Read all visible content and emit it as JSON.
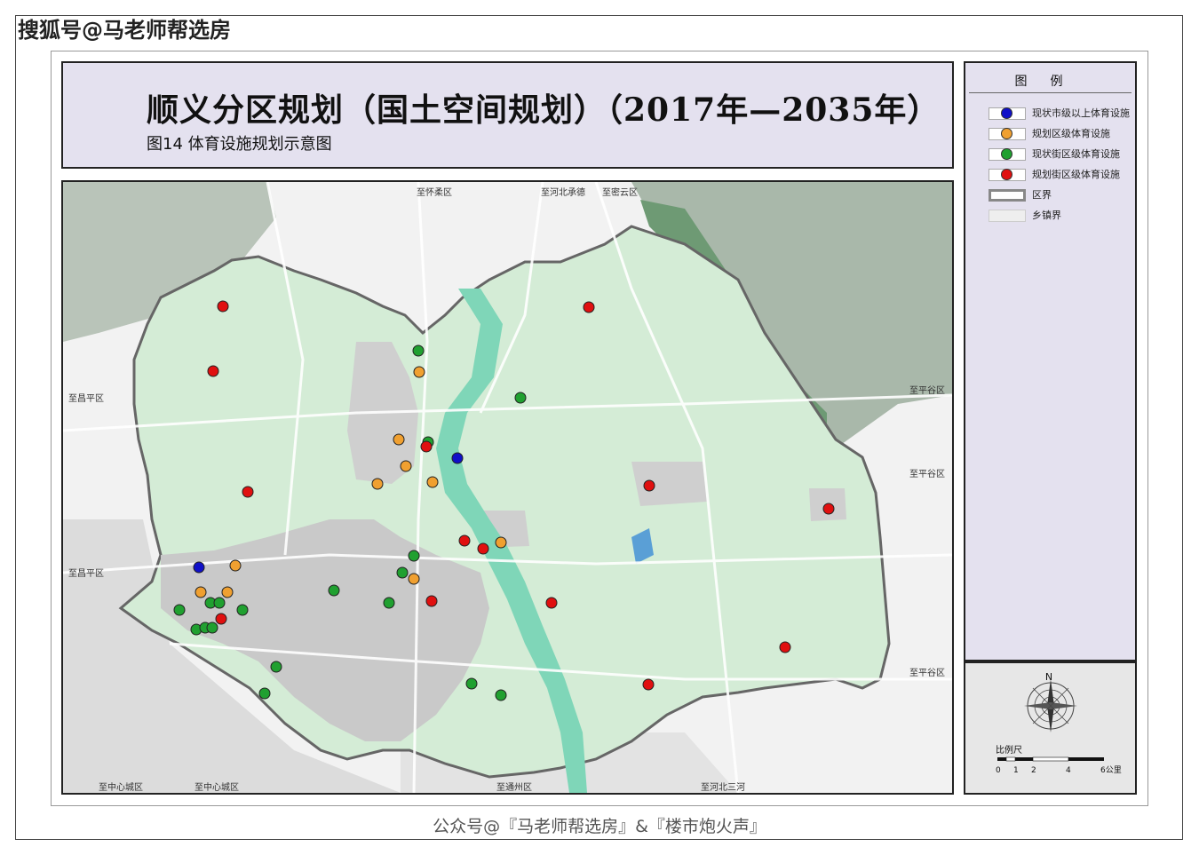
{
  "watermark": "搜狐号@马老师帮选房",
  "title": {
    "main": "顺义分区规划（国土空间规划）（2017年—2035年）",
    "sub": "图14  体育设施规划示意图"
  },
  "legend": {
    "title": "图例",
    "items": [
      {
        "label": "现状市级以上体育设施",
        "color": "#1010c8"
      },
      {
        "label": "规划区级体育设施",
        "color": "#f0a030"
      },
      {
        "label": "现状街区级体育设施",
        "color": "#20a030"
      },
      {
        "label": "规划街区级体育设施",
        "color": "#e01010"
      },
      {
        "label": "区界",
        "color": "#888888"
      },
      {
        "label": "乡镇界",
        "color": "#cccccc"
      }
    ]
  },
  "compass": {
    "north": "N"
  },
  "scale": {
    "title": "比例尺",
    "ticks": [
      "0",
      "1",
      "2",
      "4",
      "6公里"
    ]
  },
  "map_labels": {
    "huairou": "至怀柔区",
    "hebei_chengde": "至河北承德",
    "miyun": "至密云区",
    "changping_1": "至昌平区",
    "changping_2": "至昌平区",
    "pinggu_1": "至平谷区",
    "pinggu_2": "至平谷区",
    "pinggu_3": "至平谷区",
    "center_1": "至中心城区",
    "center_2": "至中心城区",
    "tongzhou": "至通州区",
    "sanhe": "至河北三河"
  },
  "facility_types": [
    "现状市级以上体育设施",
    "规划区级体育设施",
    "现状街区级体育设施",
    "规划街区级体育设施"
  ],
  "footer": "公众号@『马老师帮选房』&『楼市炮火声』"
}
